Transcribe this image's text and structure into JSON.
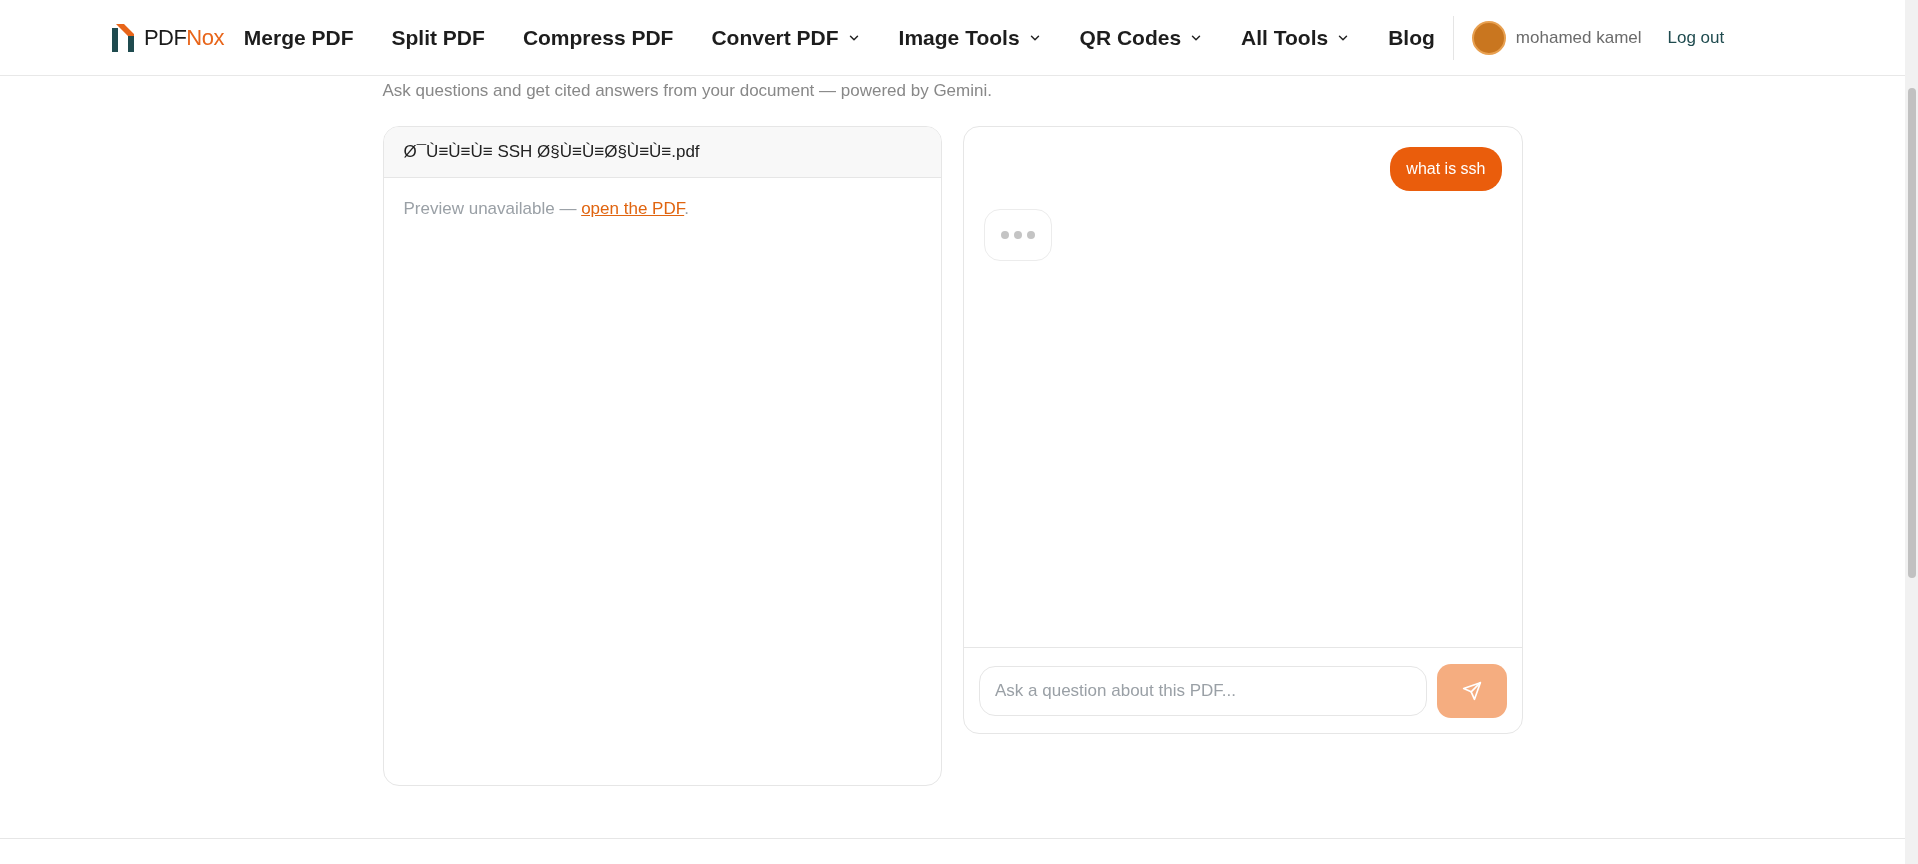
{
  "brand": {
    "prefix": "PDF",
    "suffix": "Nox"
  },
  "nav": [
    {
      "label": "Merge PDF",
      "dropdown": false
    },
    {
      "label": "Split PDF",
      "dropdown": false
    },
    {
      "label": "Compress PDF",
      "dropdown": false
    },
    {
      "label": "Convert PDF",
      "dropdown": true
    },
    {
      "label": "Image Tools",
      "dropdown": true
    },
    {
      "label": "QR Codes",
      "dropdown": true
    },
    {
      "label": "All Tools",
      "dropdown": true
    },
    {
      "label": "Blog",
      "dropdown": false
    }
  ],
  "user": {
    "name": "mohamed kamel",
    "logout": "Log out"
  },
  "subtitle": "Ask questions and get cited answers from your document — powered by Gemini.",
  "document": {
    "filename": "Ø¯Ù≡Ù≡Ù≡ SSH Ø§Ù≡Ù≡Ø§Ù≡Ù≡.pdf",
    "preview_text": "Preview unavailable — ",
    "link": "open the PDF",
    "after_link": "."
  },
  "chat": {
    "messages": [
      {
        "kind": "user",
        "text": "what is ssh"
      },
      {
        "kind": "typing"
      }
    ],
    "input": {
      "placeholder": "Ask a question about this PDF..."
    },
    "send_disabled": true
  }
}
